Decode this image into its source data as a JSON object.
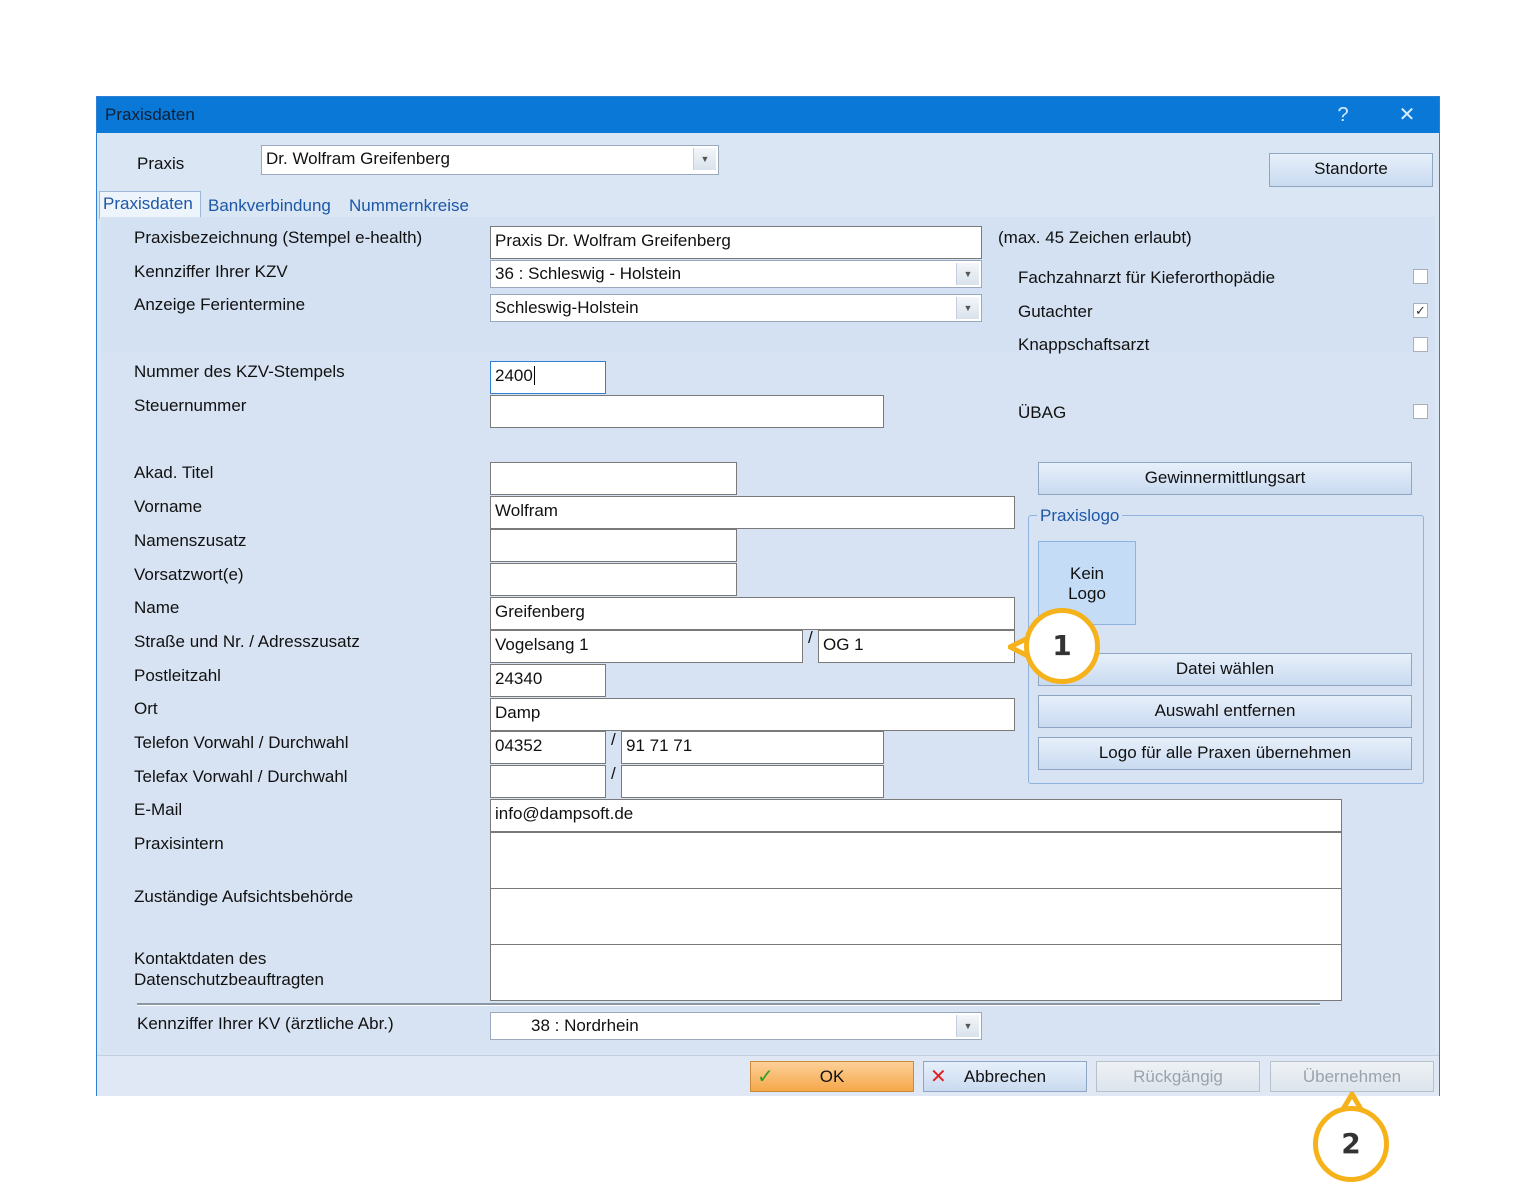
{
  "window": {
    "title": "Praxisdaten",
    "help_glyph": "?",
    "close_glyph": "✕"
  },
  "praxis": {
    "label": "Praxis",
    "value": "Dr. Wolfram Greifenberg"
  },
  "standorte_label": "Standorte",
  "tabs": [
    {
      "label": "Praxisdaten",
      "active": true
    },
    {
      "label": "Bankverbindung",
      "active": false
    },
    {
      "label": "Nummernkreise",
      "active": false
    }
  ],
  "fields": {
    "praxisbezeichnung": {
      "label": "Praxisbezeichnung (Stempel e-health)",
      "value": "Praxis Dr. Wolfram Greifenberg"
    },
    "max_hint": "(max. 45 Zeichen erlaubt)",
    "kzv": {
      "label": "Kennziffer Ihrer KZV",
      "value": "36 : Schleswig - Holstein"
    },
    "ferien": {
      "label": "Anzeige Ferientermine",
      "value": "Schleswig-Holstein"
    },
    "kzv_stempel": {
      "label": "Nummer des KZV-Stempels",
      "value": "2400"
    },
    "steuernummer": {
      "label": "Steuernummer",
      "value": ""
    },
    "titel": {
      "label": "Akad. Titel",
      "value": ""
    },
    "vorname": {
      "label": "Vorname",
      "value": "Wolfram"
    },
    "namenszusatz": {
      "label": "Namenszusatz",
      "value": ""
    },
    "vorsatzwort": {
      "label": "Vorsatzwort(e)",
      "value": ""
    },
    "name": {
      "label": "Name",
      "value": "Greifenberg"
    },
    "strasse": {
      "label": "Straße und Nr. / Adresszusatz",
      "value": "Vogelsang 1",
      "zusatz": "OG 1"
    },
    "plz": {
      "label": "Postleitzahl",
      "value": "24340"
    },
    "ort": {
      "label": "Ort",
      "value": "Damp"
    },
    "telefon": {
      "label": "Telefon Vorwahl / Durchwahl",
      "vorwahl": "04352",
      "durchwahl": "91 71 71"
    },
    "telefax": {
      "label": "Telefax Vorwahl / Durchwahl",
      "vorwahl": "",
      "durchwahl": ""
    },
    "email": {
      "label": "E-Mail",
      "value": "info@dampsoft.de"
    },
    "praxisintern": {
      "label": "Praxisintern",
      "value": ""
    },
    "aufsicht": {
      "label": "Zuständige Aufsichtsbehörde",
      "value": ""
    },
    "datenschutz": {
      "label_line1": "Kontaktdaten des",
      "label_line2": "Datenschutzbeauftragten",
      "value": ""
    },
    "kv": {
      "label": "Kennziffer Ihrer KV (ärztliche Abr.)",
      "value": "38 : Nordrhein"
    },
    "slash": "/"
  },
  "checkboxes": [
    {
      "label": "Fachzahnarzt für Kieferorthopädie",
      "checked": false
    },
    {
      "label": "Gutachter",
      "checked": true
    },
    {
      "label": "Knappschaftsarzt",
      "checked": false
    },
    {
      "label": "ÜBAG",
      "checked": false
    }
  ],
  "gewinn_label": "Gewinnermittlungsart",
  "praxislogo": {
    "title": "Praxislogo",
    "kein_line1": "Kein",
    "kein_line2": "Logo",
    "datei": "Datei wählen",
    "entfernen": "Auswahl entfernen",
    "alle": "Logo für alle Praxen übernehmen"
  },
  "footer": {
    "ok": "OK",
    "abbrechen": "Abbrechen",
    "rueckgaengig": "Rückgängig",
    "uebernehmen": "Übernehmen"
  },
  "callouts": [
    "1",
    "2"
  ],
  "colors": {
    "titlebar": "#0a78d7",
    "ok_button": "#f9b55a",
    "callout": "#f5b21a"
  }
}
